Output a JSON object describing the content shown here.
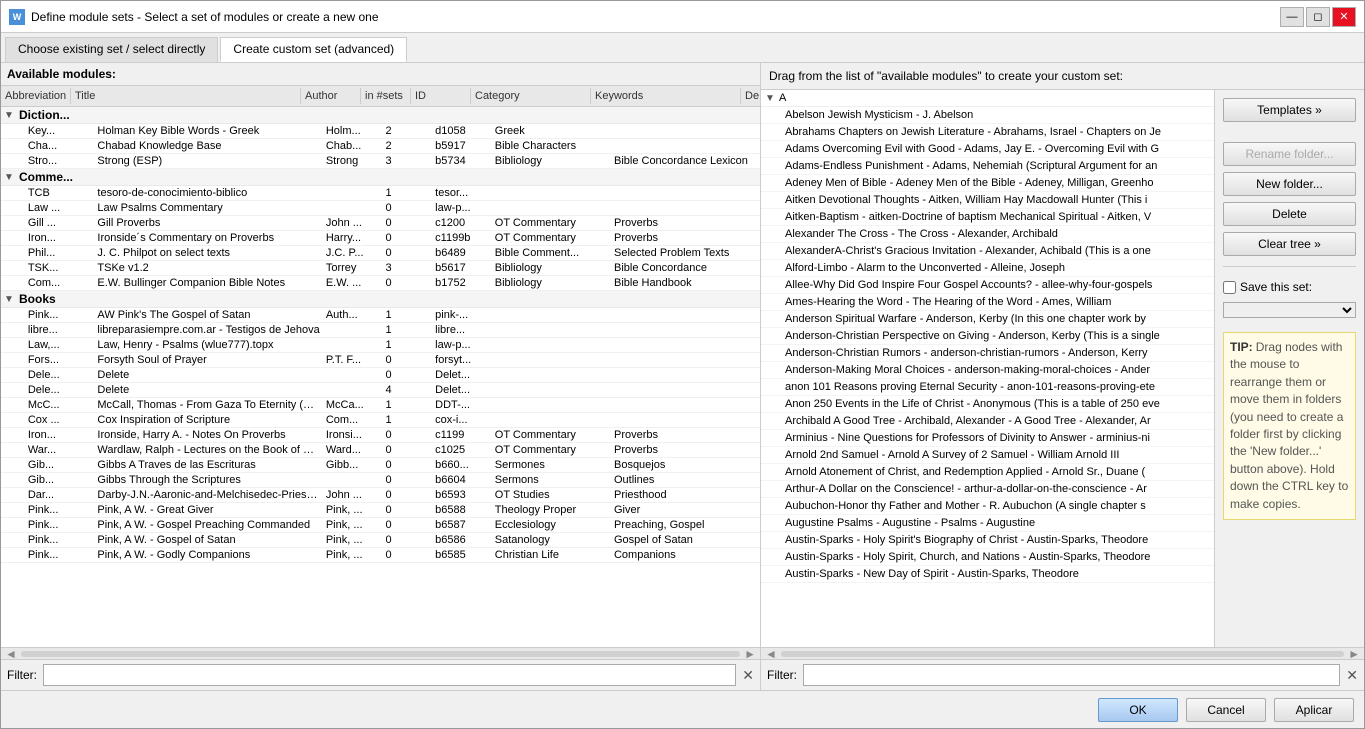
{
  "window": {
    "title": "Define module sets - Select a set of modules or create a new one",
    "icon": "W"
  },
  "tabs": [
    {
      "label": "Choose existing set / select directly",
      "active": false
    },
    {
      "label": "Create custom set (advanced)",
      "active": true
    }
  ],
  "leftPanel": {
    "header": "Available modules:",
    "columns": [
      "Abbreviation",
      "Title",
      "Author",
      "in #sets",
      "ID",
      "Category",
      "Keywords",
      "De"
    ],
    "groups": [
      {
        "label": "Diction...",
        "expanded": true,
        "rows": [
          {
            "abbr": "Key...",
            "title": "Holman Key Bible Words - Greek",
            "author": "Holm...",
            "insets": "2",
            "id": "d1058",
            "cat": "Greek",
            "kw": ""
          },
          {
            "abbr": "Cha...",
            "title": "Chabad Knowledge Base",
            "author": "Chab...",
            "insets": "2",
            "id": "b5917",
            "cat": "Bible Characters",
            "kw": ""
          },
          {
            "abbr": "Stro...",
            "title": "Strong (ESP)",
            "author": "Strong",
            "insets": "3",
            "id": "b5734",
            "cat": "Bibliology",
            "kw": "Bible Concordance Lexicon"
          }
        ]
      },
      {
        "label": "Comme...",
        "expanded": true,
        "rows": [
          {
            "abbr": "TCB",
            "title": "tesoro-de-conocimiento-biblico",
            "author": "",
            "insets": "1",
            "id": "tesor...",
            "cat": "",
            "kw": ""
          },
          {
            "abbr": "Law ...",
            "title": "Law Psalms Commentary",
            "author": "",
            "insets": "0",
            "id": "law-p...",
            "cat": "",
            "kw": ""
          },
          {
            "abbr": "Gill ...",
            "title": "Gill Proverbs",
            "author": "John ...",
            "insets": "0",
            "id": "c1200",
            "cat": "OT Commentary",
            "kw": "Proverbs"
          },
          {
            "abbr": "Iron...",
            "title": "Ironside´s Commentary on Proverbs",
            "author": "Harry...",
            "insets": "0",
            "id": "c1199b",
            "cat": "OT Commentary",
            "kw": "Proverbs"
          },
          {
            "abbr": "Phil...",
            "title": "J. C. Philpot on select texts",
            "author": "J.C. P...",
            "insets": "0",
            "id": "b6489",
            "cat": "Bible Comment...",
            "kw": "Selected Problem Texts"
          },
          {
            "abbr": "TSK...",
            "title": "TSKe v1.2",
            "author": "Torrey",
            "insets": "3",
            "id": "b5617",
            "cat": "Bibliology",
            "kw": "Bible Concordance"
          },
          {
            "abbr": "Com...",
            "title": "E.W. Bullinger Companion Bible Notes",
            "author": "E.W. ...",
            "insets": "0",
            "id": "b1752",
            "cat": "Bibliology",
            "kw": "Bible Handbook"
          }
        ]
      },
      {
        "label": "Books",
        "expanded": true,
        "rows": [
          {
            "abbr": "Pink...",
            "title": "AW Pink's The Gospel of Satan",
            "author": "Auth...",
            "insets": "1",
            "id": "pink-...",
            "cat": "",
            "kw": ""
          },
          {
            "abbr": "libre...",
            "title": "libreparasiempre.com.ar - Testigos de Jehova",
            "author": "",
            "insets": "1",
            "id": "libre...",
            "cat": "",
            "kw": ""
          },
          {
            "abbr": "Law,...",
            "title": "Law, Henry - Psalms (wlue777).topx",
            "author": "",
            "insets": "1",
            "id": "law-p...",
            "cat": "",
            "kw": ""
          },
          {
            "abbr": "Fors...",
            "title": "Forsyth Soul of Prayer",
            "author": "P.T. F...",
            "insets": "0",
            "id": "forsyt...",
            "cat": "",
            "kw": ""
          },
          {
            "abbr": "Dele...",
            "title": "Delete",
            "author": "",
            "insets": "0",
            "id": "Delet...",
            "cat": "",
            "kw": ""
          },
          {
            "abbr": "Dele...",
            "title": "Delete",
            "author": "",
            "insets": "4",
            "id": "Delet...",
            "cat": "",
            "kw": ""
          },
          {
            "abbr": "McC...",
            "title": "McCall, Thomas - From Gaza To Eternity (Pro...",
            "author": "McCa...",
            "insets": "1",
            "id": "DDT-...",
            "cat": "",
            "kw": ""
          },
          {
            "abbr": "Cox ...",
            "title": "Cox Inspiration of Scripture",
            "author": "Com...",
            "insets": "1",
            "id": "cox-i...",
            "cat": "",
            "kw": ""
          },
          {
            "abbr": "Iron...",
            "title": "Ironside, Harry A. - Notes On Proverbs",
            "author": "Ironsi...",
            "insets": "0",
            "id": "c1199",
            "cat": "OT Commentary",
            "kw": "Proverbs"
          },
          {
            "abbr": "War...",
            "title": "Wardlaw, Ralph - Lectures on the Book of Pr...",
            "author": "Ward...",
            "insets": "0",
            "id": "c1025",
            "cat": "OT Commentary",
            "kw": "Proverbs"
          },
          {
            "abbr": "Gib...",
            "title": "Gibbs A Traves de las Escrituras",
            "author": "Gibb...",
            "insets": "0",
            "id": "b660...",
            "cat": "Sermones",
            "kw": "Bosquejos"
          },
          {
            "abbr": "Gib...",
            "title": "Gibbs Through the Scriptures",
            "author": "",
            "insets": "0",
            "id": "b6604",
            "cat": "Sermons",
            "kw": "Outlines"
          },
          {
            "abbr": "Dar...",
            "title": "Darby-J.N.-Aaronic-and-Melchisedec-Priesth...",
            "author": "John ...",
            "insets": "0",
            "id": "b6593",
            "cat": "OT Studies",
            "kw": "Priesthood"
          },
          {
            "abbr": "Pink...",
            "title": "Pink, A W. - Great Giver",
            "author": "Pink, ...",
            "insets": "0",
            "id": "b6588",
            "cat": "Theology Proper",
            "kw": "Giver"
          },
          {
            "abbr": "Pink...",
            "title": "Pink, A W. - Gospel Preaching Commanded",
            "author": "Pink, ...",
            "insets": "0",
            "id": "b6587",
            "cat": "Ecclesiology",
            "kw": "Preaching, Gospel"
          },
          {
            "abbr": "Pink...",
            "title": "Pink, A W. - Gospel of Satan",
            "author": "Pink, ...",
            "insets": "0",
            "id": "b6586",
            "cat": "Satanology",
            "kw": "Gospel of Satan"
          },
          {
            "abbr": "Pink...",
            "title": "Pink, A W. - Godly Companions",
            "author": "Pink, ...",
            "insets": "0",
            "id": "b6585",
            "cat": "Christian Life",
            "kw": "Companions"
          }
        ]
      }
    ],
    "filter": {
      "label": "Filter:",
      "value": "",
      "placeholder": ""
    }
  },
  "rightPanel": {
    "header": "Drag from the list of \"available modules\" to create your custom set:",
    "filter": {
      "label": "Filter:",
      "value": "",
      "placeholder": ""
    },
    "buttons": {
      "templates": "Templates »",
      "renameFolder": "Rename folder...",
      "newFolder": "New folder...",
      "delete": "Delete",
      "clearTree": "Clear tree »"
    },
    "saveCheck": "Save this set:",
    "tip": {
      "label": "TIP:",
      "text": "Drag nodes with the mouse to rearrange them or move them in folders (you need to create a folder first by clicking the 'New folder...' button above). Hold down the CTRL key to make copies."
    },
    "nodes": [
      {
        "label": "A",
        "expanded": true,
        "items": [
          "Abelson Jewish Mysticism - J. Abelson",
          "Abrahams Chapters on Jewish Literature - Abrahams, Israel - Chapters on Je",
          "Adams Overcoming Evil with Good - Adams, Jay E. - Overcoming Evil with G",
          "Adams-Endless Punishment - Adams, Nehemiah (Scriptural Argument for an",
          "Adeney Men of Bible - Adeney Men of the Bible - Adeney, Milligan, Greenho",
          "Aitken Devotional Thoughts - Aitken, William Hay Macdowall Hunter (This i",
          "Aitken-Baptism - aitken-Doctrine of baptism Mechanical Spiritual - Aitken, V",
          "Alexander The Cross - The Cross - Alexander, Archibald",
          "AlexanderA-Christ's Gracious Invitation - Alexander, Achibald (This is a one",
          "Alford-Limbo - Alarm to the Unconverted - Alleine, Joseph",
          "Allee-Why Did God Inspire Four Gospel Accounts? - allee-why-four-gospels",
          "Ames-Hearing the Word - The Hearing of the Word - Ames, William",
          "Anderson Spiritual Warfare - Anderson, Kerby (In this one chapter work by",
          "Anderson-Christian Perspective on Giving - Anderson, Kerby (This is a single",
          "Anderson-Christian Rumors - anderson-christian-rumors - Anderson, Kerry",
          "Anderson-Making Moral Choices - anderson-making-moral-choices - Ander",
          "anon 101 Reasons proving Eternal Security - anon-101-reasons-proving-ete",
          "Anon 250 Events in the Life of Christ - Anonymous (This is a table of 250 eve",
          "Archibald A Good Tree - Archibald, Alexander - A Good Tree - Alexander, Ar",
          "Arminius - Nine Questions for Professors of Divinity to Answer - arminius-ni",
          "Arnold 2nd Samuel - Arnold A Survey of 2 Samuel - William Arnold III",
          "Arnold Atonement of Christ, and Redemption Applied - Arnold Sr., Duane (",
          "Arthur-A Dollar on the Conscience! - arthur-a-dollar-on-the-conscience - Ar",
          "Aubuchon-Honor thy Father and Mother - R. Aubuchon (A single chapter s",
          "Augustine Psalms - Augustine - Psalms - Augustine",
          "Austin-Sparks - Holy Spirit's Biography of Christ - Austin-Sparks, Theodore",
          "Austin-Sparks - Holy Spirit, Church, and Nations  - Austin-Sparks, Theodore",
          "Austin-Sparks - New Day of Spirit  - Austin-Sparks, Theodore"
        ]
      }
    ]
  },
  "bottomButtons": {
    "ok": "OK",
    "cancel": "Cancel",
    "aplicar": "Aplicar"
  }
}
